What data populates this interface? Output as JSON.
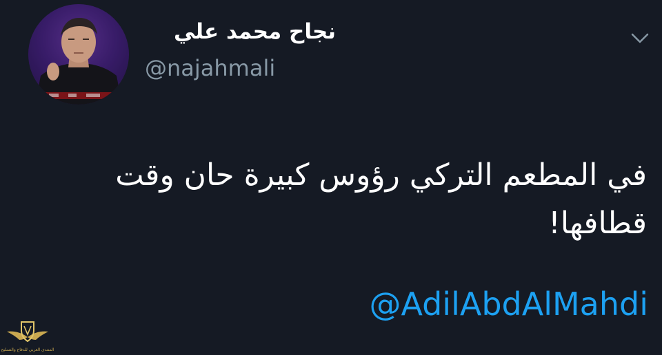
{
  "tweet": {
    "author": {
      "display_name": "نجاح محمد علي",
      "handle": "@najahmali",
      "avatar_icon": "profile-photo"
    },
    "text_lines": [
      "في المطعم التركي رؤوس كبيرة حان وقت",
      "قطافها!"
    ],
    "mention": "@AdilAbdAlMahdi",
    "menu_icon": "chevron-down-icon"
  },
  "watermark": {
    "icon": "logo-emblem",
    "label": "المنتدى العربي للدفاع والتسليح"
  },
  "colors": {
    "background": "#151a24",
    "text": "#ffffff",
    "handle": "#8899a6",
    "link": "#1da1f2",
    "chevron": "#8899a6",
    "watermark": "#c9a850"
  }
}
